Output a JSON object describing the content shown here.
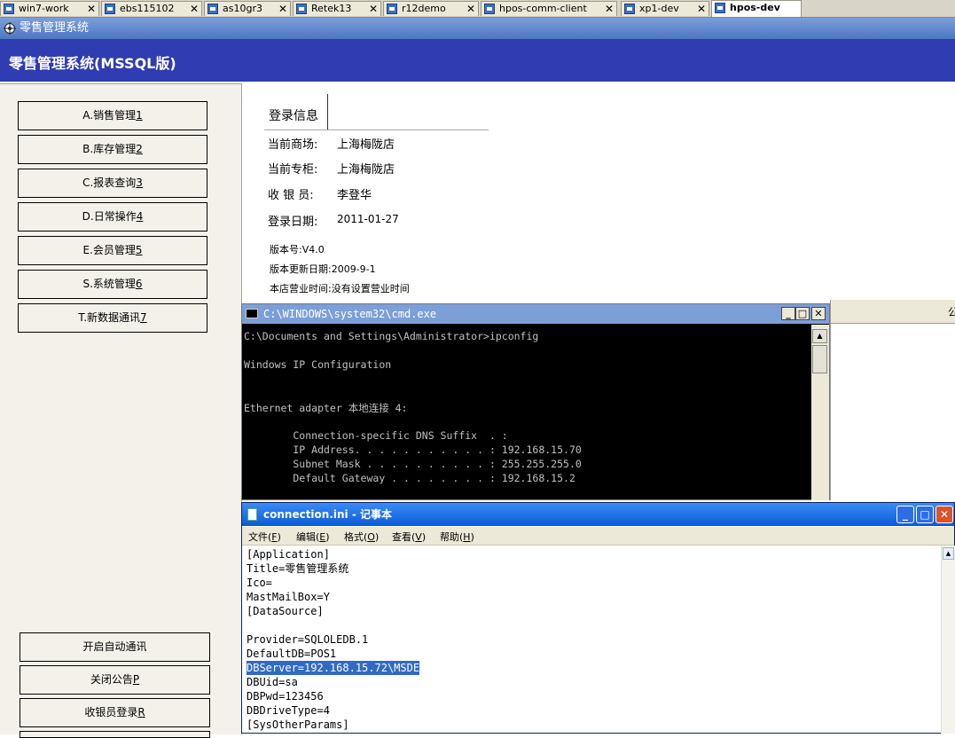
{
  "tabs": [
    {
      "label": "win7-work"
    },
    {
      "label": "ebs115102"
    },
    {
      "label": "as10gr3"
    },
    {
      "label": "Retek13"
    },
    {
      "label": "r12demo"
    },
    {
      "label": "hpos-comm-client"
    },
    {
      "label": "xp1-dev"
    },
    {
      "label": "hpos-dev"
    }
  ],
  "tab_close_glyph": "✕",
  "app": {
    "title": "零售管理系统",
    "header": "零售管理系统(MSSQL版)"
  },
  "menu": [
    {
      "text": "A.销售管理",
      "key": "1"
    },
    {
      "text": "B.库存管理",
      "key": "2"
    },
    {
      "text": "C.报表查询",
      "key": "3"
    },
    {
      "text": "D.日常操作",
      "key": "4"
    },
    {
      "text": "E.会员管理",
      "key": "5"
    },
    {
      "text": "S.系统管理",
      "key": "6"
    },
    {
      "text": "T.新数据通讯",
      "key": "7"
    }
  ],
  "bottom_buttons": [
    {
      "text": "开启自动通讯",
      "key": ""
    },
    {
      "text": "关闭公告",
      "key": "P"
    },
    {
      "text": "收银员登录",
      "key": "R"
    }
  ],
  "login_info": {
    "heading": "登录信息",
    "rows": [
      {
        "label": "当前商场:",
        "value": "上海梅陇店"
      },
      {
        "label": "当前专柜:",
        "value": "上海梅陇店"
      },
      {
        "label": "收 银 员:",
        "value": "李登华"
      },
      {
        "label": "登录日期:",
        "value": "2011-01-27"
      }
    ],
    "version": "版本号:V4.0",
    "update_date": "版本更新日期:2009-9-1",
    "business_hours": "本店营业时间:没有设置营业时间"
  },
  "cmd": {
    "title": "C:\\WINDOWS\\system32\\cmd.exe",
    "lines": [
      "C:\\Documents and Settings\\Administrator>ipconfig",
      "",
      "Windows IP Configuration",
      "",
      "",
      "Ethernet adapter 本地连接 4:",
      "",
      "        Connection-specific DNS Suffix  . :",
      "        IP Address. . . . . . . . . . . : 192.168.15.70",
      "        Subnet Mask . . . . . . . . . . : 255.255.255.0",
      "        Default Gateway . . . . . . . . : 192.168.15.2"
    ]
  },
  "right_panel_fragment": "公",
  "notepad": {
    "title": "connection.ini - 记事本",
    "menu": [
      {
        "text": "文件",
        "key": "F"
      },
      {
        "text": "编辑",
        "key": "E"
      },
      {
        "text": "格式",
        "key": "O"
      },
      {
        "text": "查看",
        "key": "V"
      },
      {
        "text": "帮助",
        "key": "H"
      }
    ],
    "lines": [
      "[Application]",
      "Title=零售管理系统",
      "Ico=",
      "MastMailBox=Y",
      "[DataSource]",
      "",
      "Provider=SQLOLEDB.1",
      "DefaultDB=POS1",
      "DBServer=192.168.15.72\\MSDE",
      "DBUid=sa",
      "DBPwd=123456",
      "DBDriveType=4",
      "[SysOtherParams]"
    ],
    "selected_line": 8
  }
}
